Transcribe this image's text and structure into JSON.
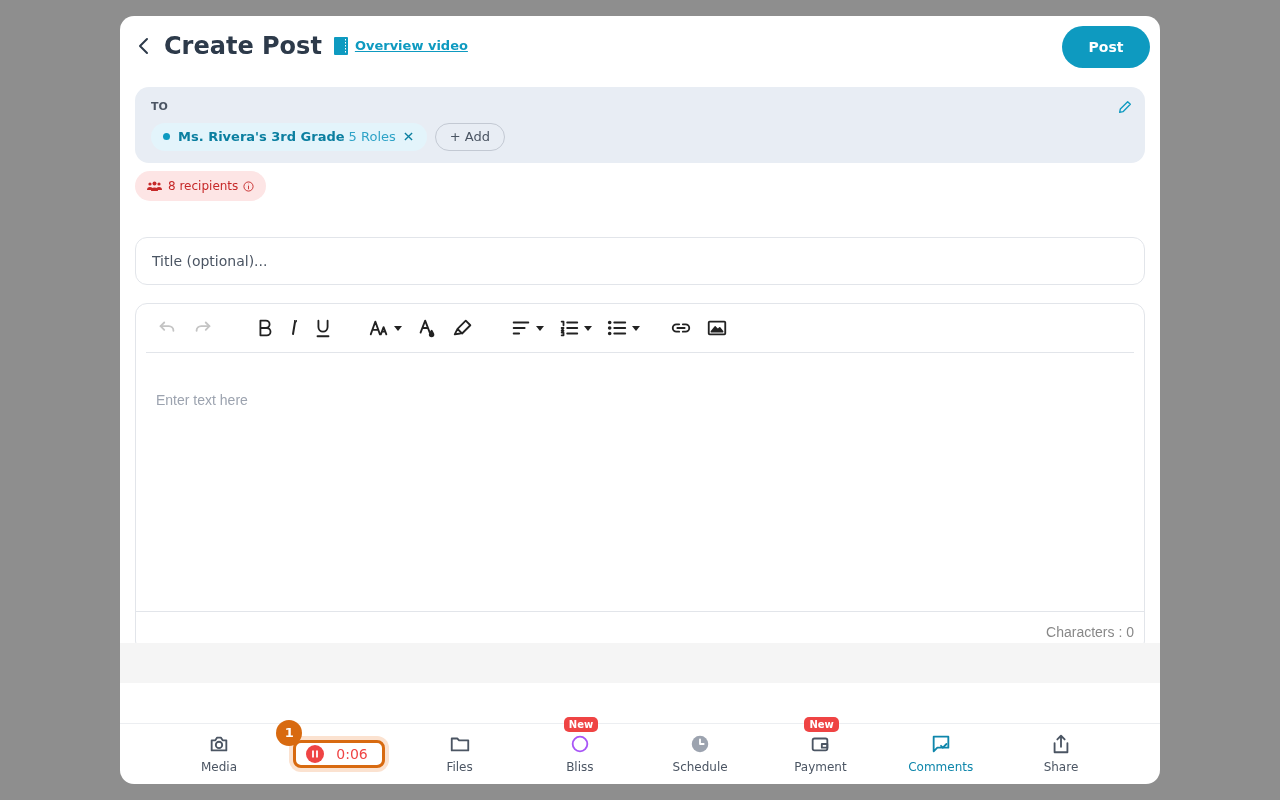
{
  "header": {
    "title": "Create Post",
    "video_link": "Overview video",
    "post_button": "Post"
  },
  "to": {
    "label": "TO",
    "chips": [
      {
        "name": "Ms. Rivera's 3rd Grade",
        "roles": "5 Roles",
        "color": "#0e9ac0"
      }
    ],
    "add_button": "+ Add"
  },
  "recipients": "8 recipients",
  "title_field": {
    "placeholder": "Title (optional)..."
  },
  "editor": {
    "toolbar": [
      {
        "kind": "undo",
        "disabled": true,
        "caret": false
      },
      {
        "kind": "redo",
        "disabled": true,
        "caret": false
      },
      {
        "kind": "bold",
        "disabled": false,
        "caret": false
      },
      {
        "kind": "italic",
        "disabled": false,
        "caret": false
      },
      {
        "kind": "underline",
        "disabled": false,
        "caret": false
      },
      {
        "kind": "font-size",
        "disabled": false,
        "caret": true
      },
      {
        "kind": "font-color",
        "disabled": false,
        "caret": false
      },
      {
        "kind": "highlight",
        "disabled": false,
        "caret": false
      },
      {
        "kind": "align",
        "disabled": false,
        "caret": true
      },
      {
        "kind": "ordered-list",
        "disabled": false,
        "caret": true
      },
      {
        "kind": "bullet-list",
        "disabled": false,
        "caret": true
      },
      {
        "kind": "link",
        "disabled": false,
        "caret": false
      },
      {
        "kind": "image",
        "disabled": false,
        "caret": false
      }
    ],
    "placeholder": "Enter text here",
    "character_count": "Characters : 0"
  },
  "bottom_bar": [
    {
      "kind": "media",
      "label": "Media",
      "selected": false
    },
    {
      "kind": "recorder",
      "step": "1",
      "time": "0:06",
      "selected": false
    },
    {
      "kind": "files",
      "label": "Files",
      "selected": false
    },
    {
      "kind": "bliss",
      "label": "Bliss",
      "badge": "New",
      "selected": false
    },
    {
      "kind": "schedule",
      "label": "Schedule",
      "selected": false
    },
    {
      "kind": "payment",
      "label": "Payment",
      "badge": "New",
      "selected": false
    },
    {
      "kind": "comments",
      "label": "Comments",
      "selected": true
    },
    {
      "kind": "share",
      "label": "Share",
      "selected": false
    }
  ]
}
